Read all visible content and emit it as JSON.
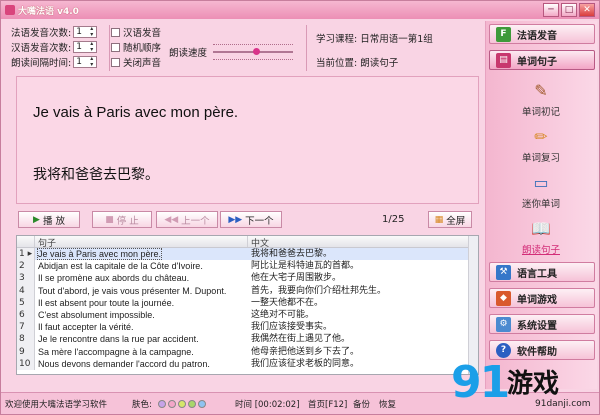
{
  "window": {
    "title": "大嘴法语 v4.0",
    "min": "─",
    "max": "□",
    "close": "✕"
  },
  "settings": {
    "spinners": [
      {
        "label": "法语发音次数:",
        "value": "1"
      },
      {
        "label": "汉语发音次数:",
        "value": "1"
      },
      {
        "label": "朗读间隔时间:",
        "value": "1"
      }
    ],
    "checkboxes": [
      {
        "label": "汉语发音"
      },
      {
        "label": "随机顺序"
      },
      {
        "label": "关闭声音"
      }
    ],
    "speed_label": "朗读速度",
    "speed_level": 0.55
  },
  "course": {
    "label": "学习课程: 日常用语一第1组",
    "position": "当前位置: 朗读句子"
  },
  "display": {
    "french": "Je vais à Paris avec mon père.",
    "chinese": "我将和爸爸去巴黎。"
  },
  "controls": {
    "play": "播 放",
    "stop": "停 止",
    "prev": "上一个",
    "next": "下一个",
    "page": "1/25",
    "fullscreen": "全屏"
  },
  "table": {
    "headers": [
      "",
      "句子",
      "中文"
    ],
    "rows": [
      {
        "n": "1",
        "fr": "Je vais à Paris avec mon père.",
        "zh": "我将和爸爸去巴黎。",
        "selected": true
      },
      {
        "n": "2",
        "fr": "Abidjan est la capitale de la Côte d'Ivoire.",
        "zh": "阿比让是科特迪瓦的首都。"
      },
      {
        "n": "3",
        "fr": "Il se promène aux abords du château.",
        "zh": "他在大宅子周围散步。"
      },
      {
        "n": "4",
        "fr": "Tout d'abord, je vais vous présenter M. Dupont.",
        "zh": "首先，我要向你们介绍杜邦先生。"
      },
      {
        "n": "5",
        "fr": "Il est absent pour toute la journée.",
        "zh": "一整天他都不在。"
      },
      {
        "n": "6",
        "fr": "C'est absolument impossible.",
        "zh": "这绝对不可能。"
      },
      {
        "n": "7",
        "fr": "Il faut accepter la vérité.",
        "zh": "我们应该接受事实。"
      },
      {
        "n": "8",
        "fr": "Je le rencontre dans la rue par accident.",
        "zh": "我偶然在街上遇见了他。"
      },
      {
        "n": "9",
        "fr": "Sa mère l'accompagne à la campagne.",
        "zh": "他母亲把他送到乡下去了。"
      },
      {
        "n": "10",
        "fr": "Nous devons demander l'accord du patron.",
        "zh": "我们应该征求老板的同意。"
      }
    ]
  },
  "statusbar": {
    "welcome": "欢迎使用大嘴法语学习软件",
    "skin_label": "肤色:",
    "skin_colors": [
      "#c6a3e8",
      "#f3a6c8",
      "#d5e66a",
      "#a8d66b",
      "#8fc2f0"
    ],
    "time": "时间 [00:02:02]",
    "home": "首页[F12]",
    "backup": "备份",
    "restore": "恢复"
  },
  "sidebar": {
    "buttons": [
      {
        "label": "法语发音",
        "icon": "F",
        "color": "#3e9a3a"
      },
      {
        "label": "单词句子",
        "icon": "▤",
        "color": "#c8386e"
      }
    ],
    "subitems": [
      {
        "label": "单词初记",
        "icon": "pen-icon"
      },
      {
        "label": "单词复习",
        "icon": "pencil-icon"
      },
      {
        "label": "迷你单词",
        "icon": "monitor-icon"
      },
      {
        "label": "朗读句子",
        "icon": "book-icon",
        "current": true
      }
    ],
    "bottom_buttons": [
      {
        "label": "语言工具",
        "icon": "tools-icon",
        "color": "#3577c9"
      },
      {
        "label": "单词游戏",
        "icon": "game-icon",
        "color": "#d95a2d"
      },
      {
        "label": "系统设置",
        "icon": "gear-icon",
        "color": "#4b8ad0"
      },
      {
        "label": "软件帮助",
        "icon": "help-icon",
        "color": "#2b5fc2"
      }
    ]
  },
  "watermark": {
    "digits": "91",
    "name": "游戏",
    "url": "91danji.com"
  }
}
